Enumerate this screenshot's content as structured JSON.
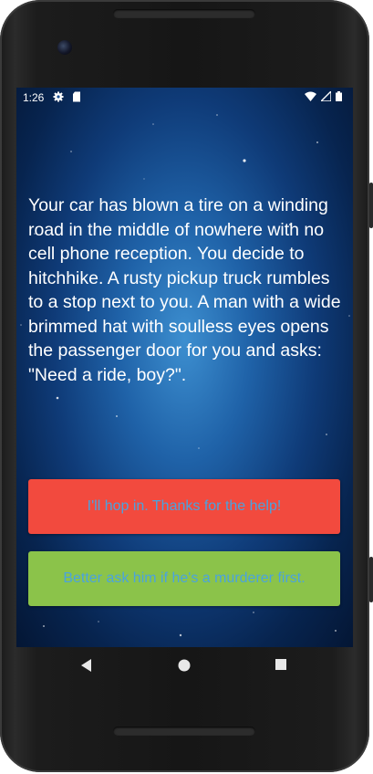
{
  "status_bar": {
    "time": "1:26",
    "left_icons": [
      "gear-icon",
      "sd-card-icon"
    ],
    "right_icons": [
      "wifi-icon",
      "signal-icon",
      "battery-icon"
    ]
  },
  "story": {
    "text": "Your car has blown a tire on a winding road in the middle of nowhere with no cell phone reception. You decide to hitchhike. A rusty pickup truck rumbles to a stop next to you. A man with a wide brimmed hat with soulless eyes opens the passenger door for you and asks: \"Need a ride, boy?\"."
  },
  "choices": [
    {
      "label": "I'll hop in. Thanks for the help!",
      "color": "#f24a3e"
    },
    {
      "label": "Better ask him if he's a murderer first.",
      "color": "#8bc34a"
    }
  ],
  "colors": {
    "choice_text": "#4aa3df",
    "background_center": "#3d8fd0",
    "background_edge": "#041634"
  },
  "nav": {
    "icons": [
      "back-triangle-icon",
      "home-circle-icon",
      "recents-square-icon"
    ]
  }
}
